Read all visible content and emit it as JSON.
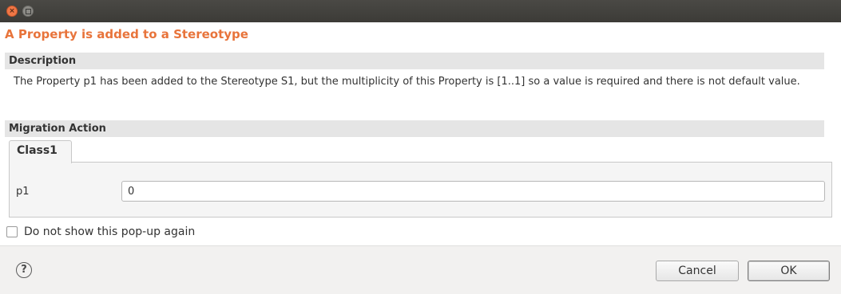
{
  "dialog": {
    "title": "A Property is added to a Stereotype"
  },
  "description": {
    "header": "Description",
    "text": "The Property p1 has been added to the Stereotype S1, but the multiplicity of this Property is [1..1] so a value is required and there is not default value."
  },
  "migration": {
    "header": "Migration Action",
    "tabs": [
      {
        "label": "Class1",
        "selected": true
      }
    ],
    "fields": [
      {
        "label": "p1",
        "value": "0"
      }
    ]
  },
  "options": {
    "do_not_show_label": "Do not show this pop-up again",
    "do_not_show_checked": false
  },
  "footer": {
    "help_icon": "question-mark-circle",
    "cancel_label": "Cancel",
    "ok_label": "OK"
  },
  "colors": {
    "title": "#e8743b",
    "titlebar": "#3c3b37",
    "close_button": "#f07746"
  }
}
